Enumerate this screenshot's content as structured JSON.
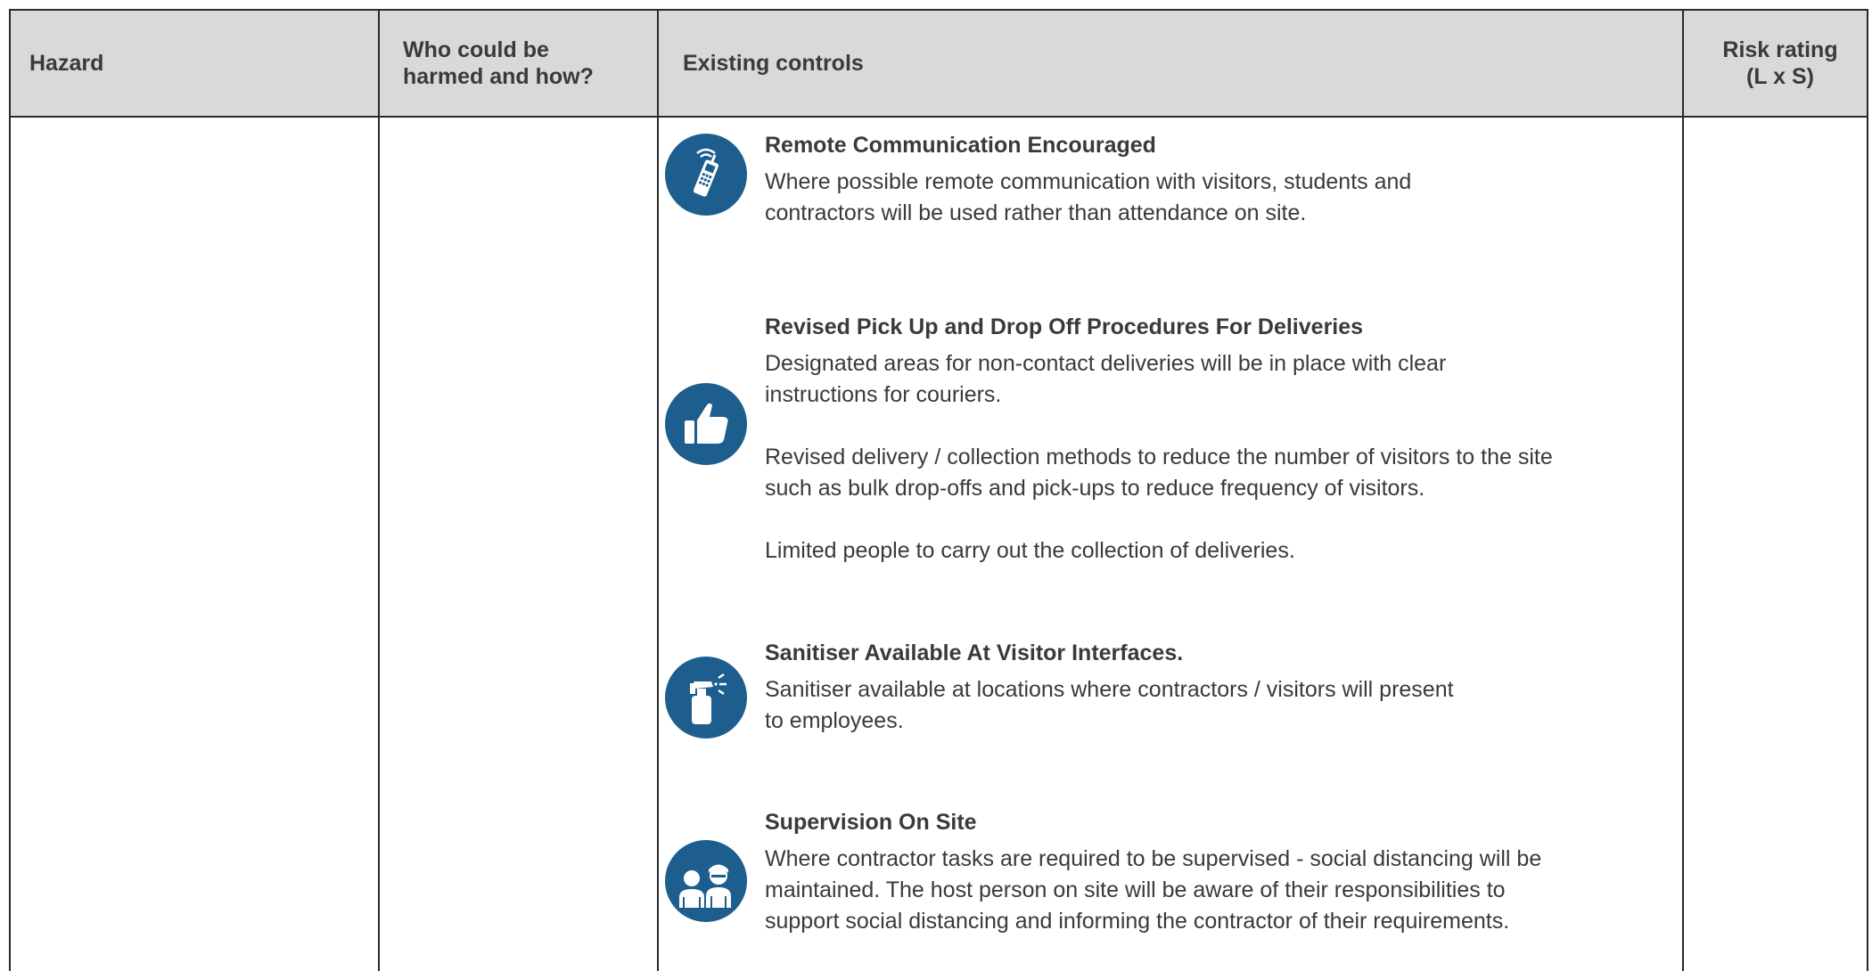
{
  "table": {
    "headers": {
      "hazard": "Hazard",
      "who_line1": "Who could be",
      "who_line2": "harmed and how?",
      "controls": "Existing controls",
      "risk_line1": "Risk rating",
      "risk_line2": "(L x S)"
    },
    "controls": [
      {
        "icon": "remote-phone-icon",
        "title": "Remote Communication  Encouraged",
        "lines": [
          "Where possible remote  communication with visitors,  students and",
          "contractors will be  used rather than attendance on  site."
        ]
      },
      {
        "icon": "thumbs-up-icon",
        "title": "Revised Pick Up and Drop Off Procedures For Deliveries",
        "para1": [
          "Designated areas for non-contact deliveries will be in place with clear",
          "instructions for couriers."
        ],
        "para2": [
          "Revised delivery / collection methods to reduce the number of visitors to the site",
          "such as bulk drop-offs and pick-ups to reduce frequency of visitors."
        ],
        "para3": [
          "Limited people to carry out the collection of deliveries."
        ]
      },
      {
        "icon": "spray-bottle-icon",
        "title": "Sanitiser Available At Visitor  Interfaces.",
        "lines": [
          "Sanitiser available at locations  where contractors / visitors will  present",
          "to employees."
        ]
      },
      {
        "icon": "supervision-people-icon",
        "title": "Supervision On Site",
        "lines": [
          "Where contractor tasks are required to be supervised - social distancing will be",
          "maintained. The host person on site will be aware of their responsibilities to",
          "support social distancing and informing the contractor of their requirements."
        ]
      }
    ]
  },
  "colors": {
    "header_bg": "#d9d9d9",
    "icon_blue": "#1d5e8e",
    "text": "#3a3a3a",
    "border": "#2a2a2a"
  }
}
